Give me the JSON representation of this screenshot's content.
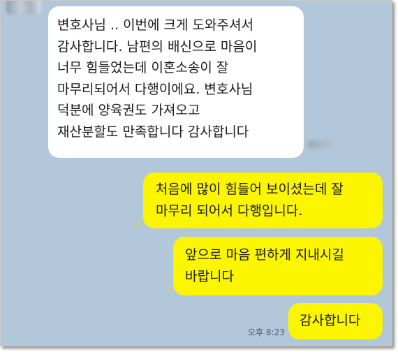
{
  "chat": {
    "messages": [
      {
        "sender": "other",
        "text": "변호사님 .. 이번에 크게 도와주셔서\n감사합니다. 남편의 배신으로 마음이\n너무 힘들었는데 이혼소송이 잘\n마무리되어서 다행이에요. 변호사님\n덕분에 양육권도 가져오고\n재산분할도 만족합니다 감사합니다"
      },
      {
        "sender": "me",
        "text": "처음에 많이 힘들어 보이셨는데 잘\n마무리 되어서 다행입니다.",
        "read_count": "1"
      },
      {
        "sender": "me",
        "text": "앞으로 마음 편하게 지내시길\n바랍니다",
        "read_count": "1"
      },
      {
        "sender": "me",
        "text": "감사합니다",
        "read_count": "1",
        "time": "오후 8:23"
      }
    ]
  },
  "colors": {
    "background": "#b2c7d9",
    "incoming_bubble": "#ffffff",
    "outgoing_bubble": "#fbf500",
    "read_count": "#e8d400"
  }
}
